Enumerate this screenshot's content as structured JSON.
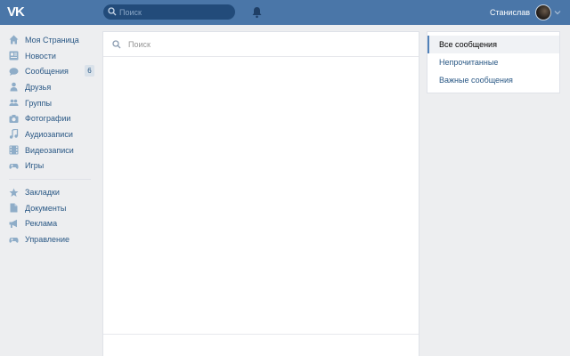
{
  "header": {
    "logo_text": "VK",
    "search_placeholder": "Поиск",
    "user_name": "Станислав",
    "brand_color": "#4a76a8"
  },
  "sidebar": {
    "items": [
      {
        "label": "Моя Страница",
        "icon": "home-icon"
      },
      {
        "label": "Новости",
        "icon": "news-icon"
      },
      {
        "label": "Сообщения",
        "icon": "messages-icon",
        "badge": "6"
      },
      {
        "label": "Друзья",
        "icon": "friend-icon"
      },
      {
        "label": "Группы",
        "icon": "groups-icon"
      },
      {
        "label": "Фотографии",
        "icon": "camera-icon"
      },
      {
        "label": "Аудиозаписи",
        "icon": "music-note-icon"
      },
      {
        "label": "Видеозаписи",
        "icon": "film-icon"
      },
      {
        "label": "Игры",
        "icon": "gamepad-icon"
      }
    ],
    "secondary": [
      {
        "label": "Закладки",
        "icon": "star-icon"
      },
      {
        "label": "Документы",
        "icon": "document-icon"
      },
      {
        "label": "Реклама",
        "icon": "megaphone-icon"
      },
      {
        "label": "Управление",
        "icon": "gamepad-icon"
      }
    ]
  },
  "main": {
    "search_placeholder": "Поиск"
  },
  "right_menu": {
    "items": [
      {
        "label": "Все сообщения",
        "active": true
      },
      {
        "label": "Непрочитанные"
      },
      {
        "label": "Важные сообщения"
      }
    ]
  }
}
